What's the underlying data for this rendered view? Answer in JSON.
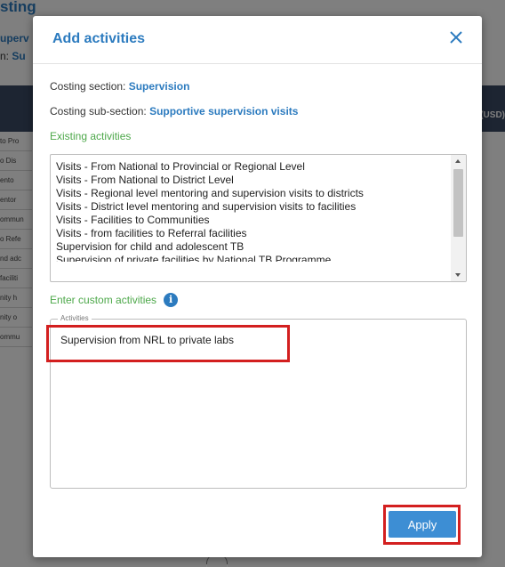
{
  "background": {
    "title_fragment": "sting",
    "sub1_fragment": "uperv",
    "sub2_label_fragment": "n: ",
    "sub2_value_fragment": "Su",
    "column_header_fragment": "(USD)",
    "row_fragments": [
      "to Pro",
      "o Dis",
      "ento",
      "entor",
      "ommun",
      "o Refe",
      "nd adc",
      "faciliti",
      "nity h",
      "nity o",
      "ommu"
    ]
  },
  "modal": {
    "title": "Add activities",
    "costing_section_label": "Costing section: ",
    "costing_section_value": "Supervision",
    "costing_subsection_label": "Costing sub-section: ",
    "costing_subsection_value": "Supportive supervision visits",
    "existing_activities_label": "Existing activities",
    "existing_activities": [
      "Visits - From National to Provincial or Regional Level",
      "Visits - From National to District Level",
      "Visits - Regional level mentoring and supervision visits to districts",
      "Visits - District level mentoring and supervision visits to facilities",
      "Visits - Facilities to Communities",
      "Visits - from facilities to Referral facilities",
      "Supervision for child and adolescent TB",
      "Supervision of private facilities by National TB Programme"
    ],
    "custom_activities_label": "Enter custom activities",
    "info_icon_glyph": "i",
    "activities_legend": "Activities",
    "activities_value": "Supervision from NRL to private labs",
    "apply_label": "Apply"
  },
  "colors": {
    "accent_blue": "#2c7bbf",
    "button_blue": "#3d8ed4",
    "section_green": "#4da84a",
    "highlight_red": "#d31f1f",
    "table_header": "#3a4a64"
  },
  "icons": {
    "close": "close-icon",
    "info": "info-icon",
    "scroll_up": "scroll-up-arrow-icon",
    "scroll_down": "scroll-down-arrow-icon"
  }
}
